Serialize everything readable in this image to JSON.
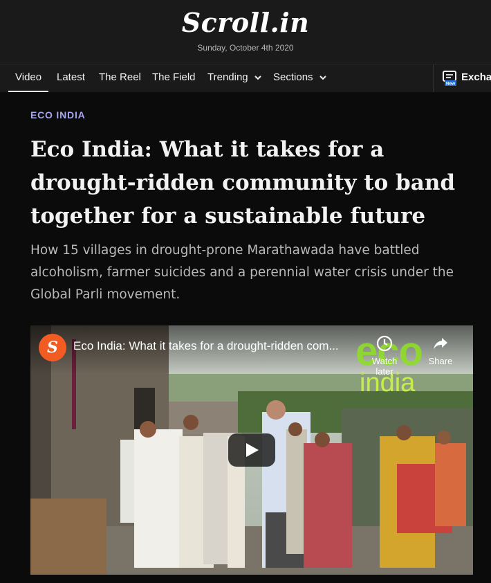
{
  "site": {
    "logo": "Scroll.in",
    "date": "Sunday, October 4th 2020"
  },
  "nav": {
    "items": [
      {
        "label": "Video",
        "active": true
      },
      {
        "label": "Latest"
      },
      {
        "label": "The Reel"
      },
      {
        "label": "The Field"
      },
      {
        "label": "Trending",
        "has_dropdown": true
      },
      {
        "label": "Sections",
        "has_dropdown": true
      }
    ],
    "exchange": {
      "label": "Exchange",
      "badge": "New",
      "icon": "chat-bubble-icon"
    }
  },
  "article": {
    "kicker": "ECO INDIA",
    "headline": "Eco India: What it takes for a drought-ridden community to band together for a sustainable future",
    "subhead": "How 15 villages in drought-prone Marathawada have battled alcoholism, farmer suicides and a perennial water crisis under the Global Parli movement."
  },
  "video": {
    "channel_icon": "scroll-logo-icon",
    "title": "Eco India: What it takes for a drought-ridden com...",
    "overlay_eco": "eco",
    "overlay_india": "india",
    "watch_later_label": "Watch later",
    "share_label": "Share",
    "play_icon": "play-icon"
  },
  "colors": {
    "page_bg": "#0b0b0c",
    "header_bg": "#1a1a1b",
    "kicker": "#a7a7f0",
    "accent_logo": "#f25c22",
    "eco_green": "#8fdc2a"
  }
}
